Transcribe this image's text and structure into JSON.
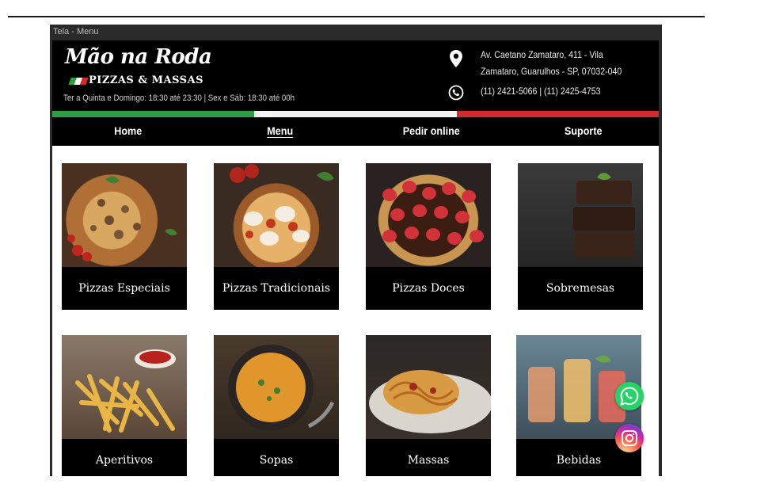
{
  "window": {
    "title": "Tela - Menu"
  },
  "brand": {
    "name": "Mão na Roda",
    "tagline": "PIZZAS & MASSAS"
  },
  "header": {
    "hours": "Ter a Quinta e Domingo: 18:30 até 23:30 | Sex e Sáb: 18:30 até 00h",
    "address_line1": "Av. Caetano Zamataro, 411 - Vila",
    "address_line2": "Zamataro, Guarulhos - SP, 07032-040",
    "phones": "(11) 2421-5066 | (11) 2425-4753"
  },
  "flag_colors": [
    "#2e9e44",
    "#ffffff",
    "#d32b2b"
  ],
  "nav": {
    "items": [
      {
        "label": "Home"
      },
      {
        "label": "Menu"
      },
      {
        "label": "Pedir online"
      },
      {
        "label": "Suporte"
      }
    ],
    "active": "Menu"
  },
  "categories": [
    {
      "label": "Pizzas Especiais"
    },
    {
      "label": "Pizzas Tradicionais"
    },
    {
      "label": "Pizzas Doces"
    },
    {
      "label": "Sobremesas"
    },
    {
      "label": "Aperitivos"
    },
    {
      "label": "Sopas"
    },
    {
      "label": "Massas"
    },
    {
      "label": "Bebidas"
    }
  ],
  "floating_buttons": [
    {
      "icon": "whatsapp-icon",
      "color": "#25d366"
    },
    {
      "icon": "instagram-icon",
      "color": "#d62976"
    }
  ]
}
